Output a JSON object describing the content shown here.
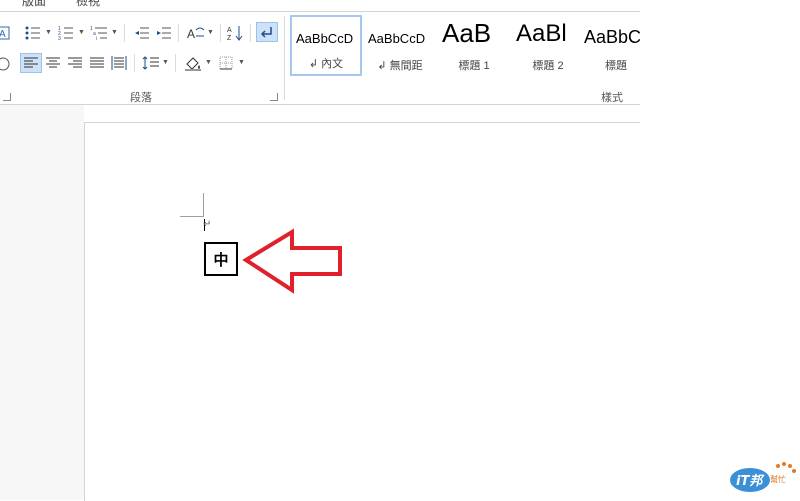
{
  "ribbon": {
    "tabs": [
      "版面",
      "檢視"
    ],
    "paragraph_group": {
      "label": "段落",
      "buttons": [
        {
          "name": "bullets",
          "icon": "bullet-list-icon",
          "has_dropdown": true
        },
        {
          "name": "numbering",
          "icon": "numbered-list-icon",
          "has_dropdown": true
        },
        {
          "name": "multilevel",
          "icon": "multilevel-list-icon",
          "has_dropdown": true
        },
        {
          "name": "decrease-indent",
          "icon": "decrease-indent-icon"
        },
        {
          "name": "increase-indent",
          "icon": "increase-indent-icon"
        },
        {
          "name": "chinese-layout",
          "icon": "chinese-layout-icon",
          "has_dropdown": true
        },
        {
          "name": "sort",
          "icon": "sort-az-icon"
        },
        {
          "name": "show-marks",
          "icon": "paragraph-mark-icon",
          "active": true
        },
        {
          "name": "align-left",
          "icon": "align-left-icon",
          "active": true
        },
        {
          "name": "align-center",
          "icon": "align-center-icon"
        },
        {
          "name": "align-right",
          "icon": "align-right-icon"
        },
        {
          "name": "justify",
          "icon": "justify-icon"
        },
        {
          "name": "distributed",
          "icon": "distributed-icon"
        },
        {
          "name": "line-spacing",
          "icon": "line-spacing-icon",
          "has_dropdown": true
        },
        {
          "name": "shading",
          "icon": "shading-icon",
          "has_dropdown": true
        },
        {
          "name": "borders",
          "icon": "borders-icon",
          "has_dropdown": true
        }
      ]
    },
    "styles_group": {
      "label": "樣式",
      "items": [
        {
          "sample": "AaBbCcD",
          "name": "↲ 內文",
          "selected": true
        },
        {
          "sample": "AaBbCcD",
          "name": "↲ 無間距"
        },
        {
          "sample": "AaB",
          "name": "標題 1"
        },
        {
          "sample": "AaBl",
          "name": "標題 2"
        },
        {
          "sample": "AaBbC",
          "name": "標題"
        }
      ]
    }
  },
  "document": {
    "paragraph_mark": "↵",
    "ime_indicator": "中"
  },
  "colors": {
    "accent": "#cde1f7",
    "arrow": "#e0202a"
  },
  "watermark": {
    "text": "iT邦幫忙"
  }
}
